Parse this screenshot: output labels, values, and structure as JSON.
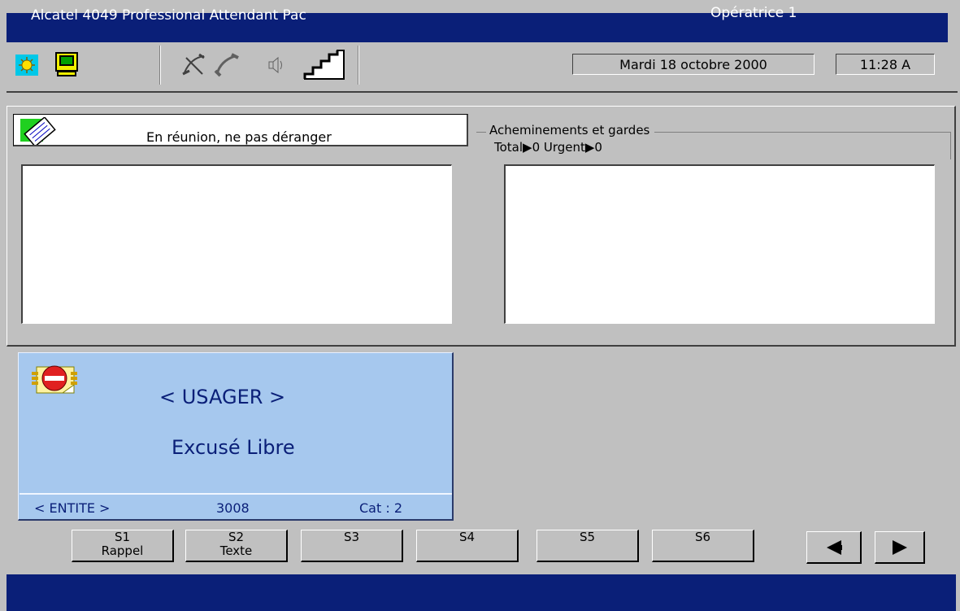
{
  "window": {
    "title": "Alcatel 4049 Professional Attendant Pac",
    "operator": "Opératrice 1"
  },
  "toolbar": {
    "icons": [
      "sun-icon",
      "monitor-icon",
      "hang-up-icon",
      "handset-icon",
      "speaker-icon",
      "volume-ramp-icon"
    ],
    "date": "Mardi 18 octobre 2000",
    "time": "11:28 A"
  },
  "message": {
    "icon": "memo-icon",
    "text": "En réunion, ne pas déranger"
  },
  "routing": {
    "title": "Acheminements et gardes",
    "counts": "Total▶0  Urgent▶0"
  },
  "user_card": {
    "icon": "do-not-disturb-icon",
    "name": "< USAGER >",
    "status": "Excusé Libre",
    "entity": "< ENTITE >",
    "number": "3008",
    "category": "Cat : 2"
  },
  "softkeys": [
    {
      "line1": "S1",
      "line2": "Rappel"
    },
    {
      "line1": "S2",
      "line2": "Texte"
    },
    {
      "line1": "S3",
      "line2": ""
    },
    {
      "line1": "S4",
      "line2": ""
    },
    {
      "line1": "S5",
      "line2": ""
    },
    {
      "line1": "S6",
      "line2": ""
    }
  ],
  "colors": {
    "title_bar": "#0a1f78",
    "card_background": "#a6c8ee",
    "card_text": "#0a1f78"
  }
}
